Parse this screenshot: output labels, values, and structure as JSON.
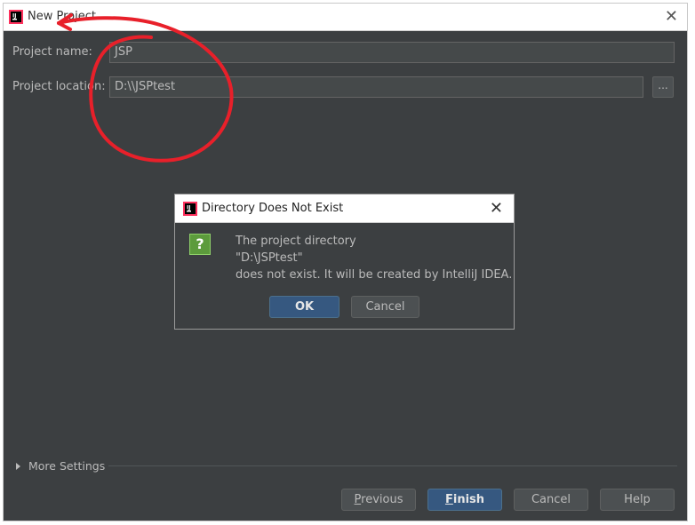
{
  "window": {
    "title": "New Project",
    "close_glyph": "✕"
  },
  "form": {
    "project_name_label": "Project name:",
    "project_name_value": "JSP",
    "project_location_label": "Project location:",
    "project_location_value": "D:\\\\JSPtest",
    "browse_label": "..."
  },
  "more_settings": "More Settings",
  "footer": {
    "previous_prefix": "P",
    "previous_rest": "revious",
    "finish_prefix": "F",
    "finish_rest": "inish",
    "cancel": "Cancel",
    "help": "Help"
  },
  "dialog": {
    "title": "Directory Does Not Exist",
    "close_glyph": "✕",
    "icon_glyph": "?",
    "line1": "The project directory",
    "line2": "\"D:\\JSPtest\"",
    "line3": "does not exist. It will be created by IntelliJ IDEA.",
    "ok": "OK",
    "cancel": "Cancel"
  },
  "icons": {
    "app": "intellij-logo-icon",
    "question": "question-icon",
    "expand": "triangle-right-icon"
  },
  "colors": {
    "background": "#3c3f41",
    "primary_button": "#365880",
    "annotation": "#e8202a"
  }
}
